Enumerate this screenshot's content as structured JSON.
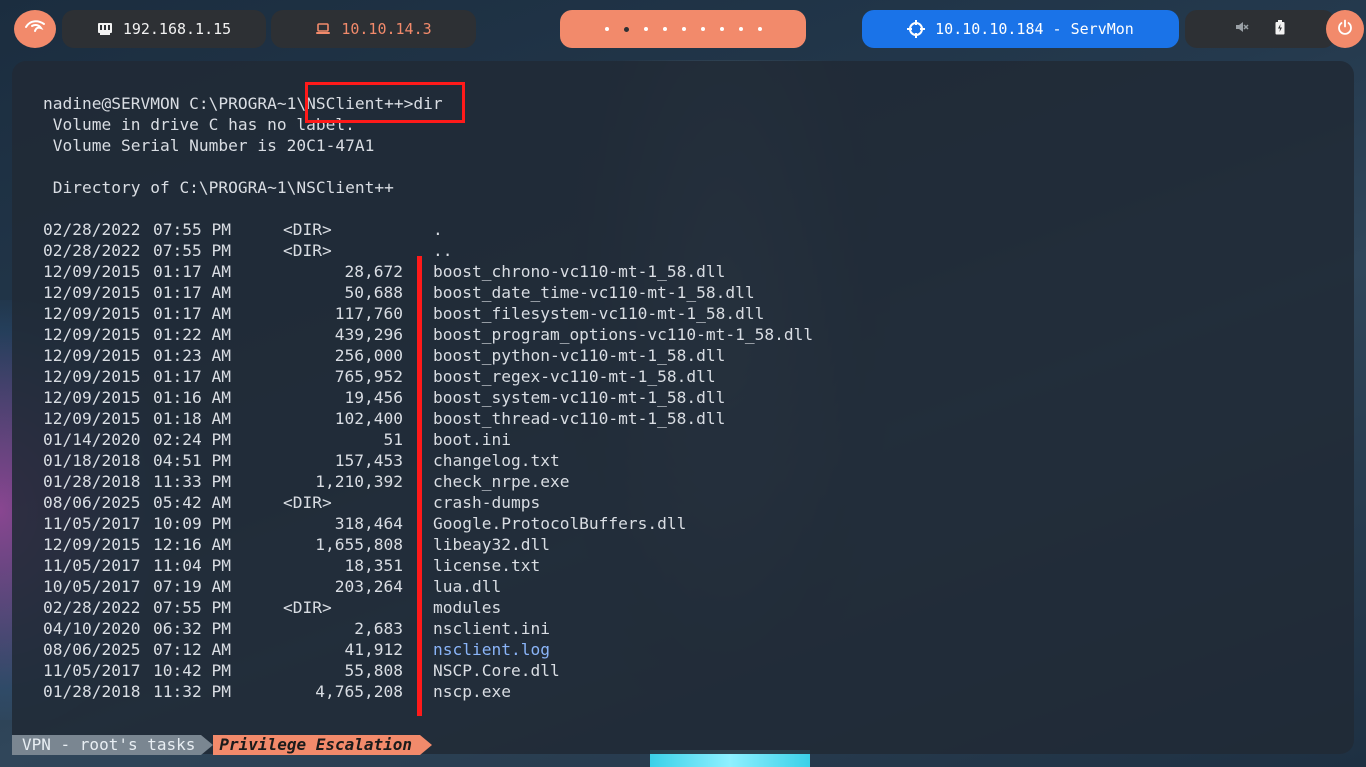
{
  "topbar": {
    "launcher_icon": "kali-dragon-icon",
    "local_ip": "192.168.1.15",
    "vpn_ip": "10.10.14.3",
    "workspaces": {
      "count": 9,
      "active_index": 1
    },
    "target": "10.10.10.184 - ServMon",
    "status_icons": [
      "mute-icon",
      "battery-icon"
    ],
    "power_icon": "power-icon",
    "colors": {
      "accent": "#f28a6b",
      "target_bg": "#1a73e8",
      "pill_bg": "#2d3034"
    }
  },
  "terminal": {
    "header_lines": [
      "nadine@SERVMON C:\\PROGRA~1\\NSClient++>dir",
      " Volume in drive C has no label.",
      " Volume Serial Number is 20C1-47A1",
      "",
      " Directory of C:\\PROGRA~1\\NSClient++",
      ""
    ],
    "entries": [
      {
        "date": "02/28/2022",
        "time": "07:55 PM",
        "dir": "<DIR>",
        "size": "",
        "name": "."
      },
      {
        "date": "02/28/2022",
        "time": "07:55 PM",
        "dir": "<DIR>",
        "size": "",
        "name": ".."
      },
      {
        "date": "12/09/2015",
        "time": "01:17 AM",
        "dir": "",
        "size": "28,672",
        "name": "boost_chrono-vc110-mt-1_58.dll"
      },
      {
        "date": "12/09/2015",
        "time": "01:17 AM",
        "dir": "",
        "size": "50,688",
        "name": "boost_date_time-vc110-mt-1_58.dll"
      },
      {
        "date": "12/09/2015",
        "time": "01:17 AM",
        "dir": "",
        "size": "117,760",
        "name": "boost_filesystem-vc110-mt-1_58.dll"
      },
      {
        "date": "12/09/2015",
        "time": "01:22 AM",
        "dir": "",
        "size": "439,296",
        "name": "boost_program_options-vc110-mt-1_58.dll"
      },
      {
        "date": "12/09/2015",
        "time": "01:23 AM",
        "dir": "",
        "size": "256,000",
        "name": "boost_python-vc110-mt-1_58.dll"
      },
      {
        "date": "12/09/2015",
        "time": "01:17 AM",
        "dir": "",
        "size": "765,952",
        "name": "boost_regex-vc110-mt-1_58.dll"
      },
      {
        "date": "12/09/2015",
        "time": "01:16 AM",
        "dir": "",
        "size": "19,456",
        "name": "boost_system-vc110-mt-1_58.dll"
      },
      {
        "date": "12/09/2015",
        "time": "01:18 AM",
        "dir": "",
        "size": "102,400",
        "name": "boost_thread-vc110-mt-1_58.dll"
      },
      {
        "date": "01/14/2020",
        "time": "02:24 PM",
        "dir": "",
        "size": "51",
        "name": "boot.ini"
      },
      {
        "date": "01/18/2018",
        "time": "04:51 PM",
        "dir": "",
        "size": "157,453",
        "name": "changelog.txt"
      },
      {
        "date": "01/28/2018",
        "time": "11:33 PM",
        "dir": "",
        "size": "1,210,392",
        "name": "check_nrpe.exe"
      },
      {
        "date": "08/06/2025",
        "time": "05:42 AM",
        "dir": "<DIR>",
        "size": "",
        "name": "crash-dumps"
      },
      {
        "date": "11/05/2017",
        "time": "10:09 PM",
        "dir": "",
        "size": "318,464",
        "name": "Google.ProtocolBuffers.dll"
      },
      {
        "date": "12/09/2015",
        "time": "12:16 AM",
        "dir": "",
        "size": "1,655,808",
        "name": "libeay32.dll"
      },
      {
        "date": "11/05/2017",
        "time": "11:04 PM",
        "dir": "",
        "size": "18,351",
        "name": "license.txt"
      },
      {
        "date": "10/05/2017",
        "time": "07:19 AM",
        "dir": "",
        "size": "203,264",
        "name": "lua.dll"
      },
      {
        "date": "02/28/2022",
        "time": "07:55 PM",
        "dir": "<DIR>",
        "size": "",
        "name": "modules"
      },
      {
        "date": "04/10/2020",
        "time": "06:32 PM",
        "dir": "",
        "size": "2,683",
        "name": "nsclient.ini"
      },
      {
        "date": "08/06/2025",
        "time": "07:12 AM",
        "dir": "",
        "size": "41,912",
        "name": "nsclient.log",
        "highlight": true
      },
      {
        "date": "11/05/2017",
        "time": "10:42 PM",
        "dir": "",
        "size": "55,808",
        "name": "NSCP.Core.dll"
      },
      {
        "date": "01/28/2018",
        "time": "11:32 PM",
        "dir": "",
        "size": "4,765,208",
        "name": "nscp.exe"
      }
    ]
  },
  "statusline": {
    "session": "VPN - root's tasks",
    "window": "Privilege Escalation"
  }
}
